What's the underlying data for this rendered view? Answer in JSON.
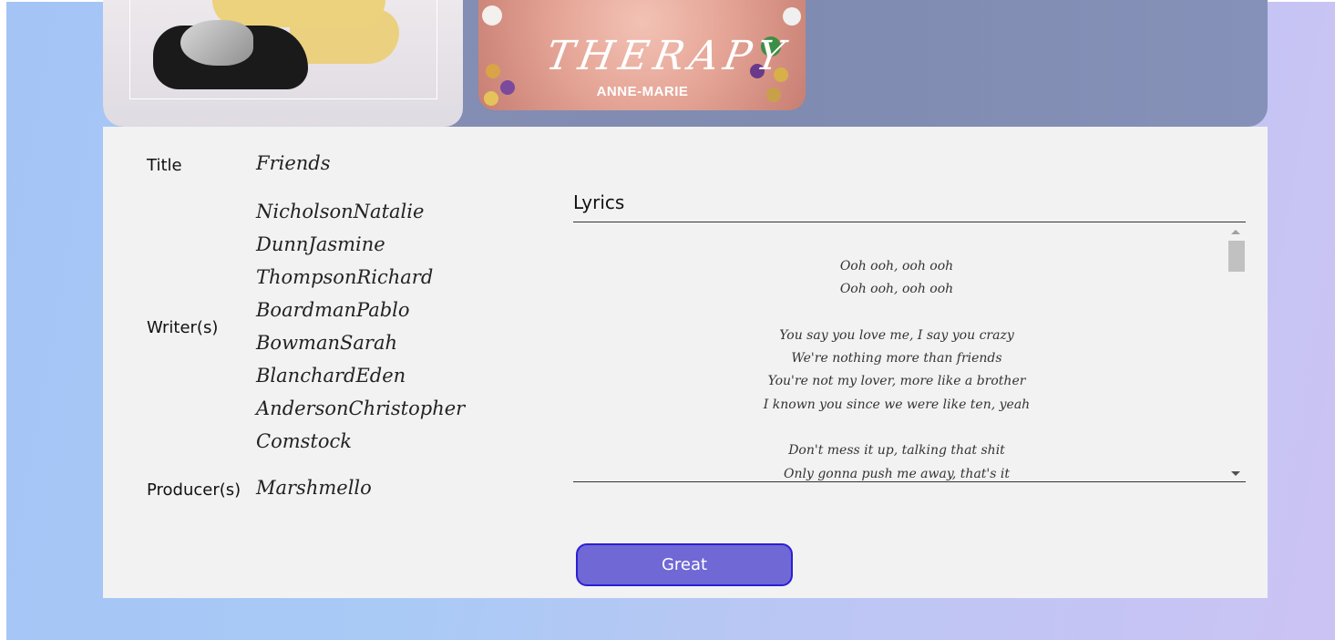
{
  "album": {
    "cover_title": "THERAPY",
    "cover_artist": "ANNE-MARIE"
  },
  "song": {
    "title_label": "Title",
    "title_value": "Friends",
    "writers_label": "Writer(s)",
    "writers": [
      "NicholsonNatalie",
      "DunnJasmine",
      "ThompsonRichard",
      "BoardmanPablo",
      "BowmanSarah",
      "BlanchardEden",
      "AndersonChristopher",
      "Comstock"
    ],
    "producers_label": "Producer(s)",
    "producers_value": "Marshmello"
  },
  "lyrics": {
    "heading": "Lyrics",
    "lines": [
      "Ooh ooh, ooh ooh",
      "Ooh ooh, ooh ooh",
      "",
      "You say you love me, I say you crazy",
      "We're nothing more than friends",
      "You're not my lover, more like a brother",
      "I known you since we were like ten, yeah",
      "",
      "Don't mess it up, talking that shit",
      "Only gonna push me away, that's it"
    ]
  },
  "actions": {
    "great_label": "Great"
  },
  "colors": {
    "button_fill": "#7068d4",
    "button_border": "#2b1fd6",
    "card_background": "#f2f2f2"
  }
}
